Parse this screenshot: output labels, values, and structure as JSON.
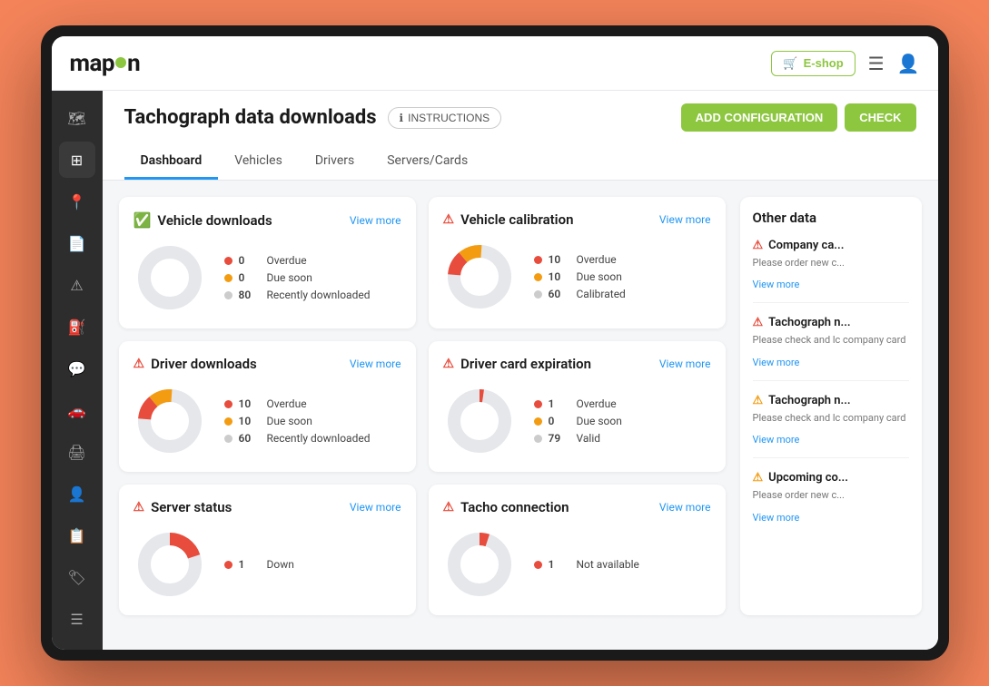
{
  "app": {
    "logo": "map",
    "logo_highlight": "on",
    "eshop_label": "E-shop",
    "page_title": "Tachograph data downloads",
    "instructions_label": "INSTRUCTIONS",
    "add_config_label": "ADD CONFIGURATION",
    "check_label": "CHECK"
  },
  "tabs": [
    {
      "label": "Dashboard",
      "active": true
    },
    {
      "label": "Vehicles",
      "active": false
    },
    {
      "label": "Drivers",
      "active": false
    },
    {
      "label": "Servers/Cards",
      "active": false
    }
  ],
  "cards": [
    {
      "id": "vehicle-downloads",
      "title": "Vehicle downloads",
      "status": "ok",
      "view_more": "View more",
      "legend": [
        {
          "color": "#e74c3c",
          "count": "0",
          "label": "Overdue"
        },
        {
          "color": "#f39c12",
          "count": "0",
          "label": "Due soon"
        },
        {
          "color": "#cccccc",
          "count": "80",
          "label": "Recently downloaded"
        }
      ],
      "donut": {
        "segments": [
          {
            "color": "#e5e7eb",
            "value": 100
          }
        ]
      }
    },
    {
      "id": "vehicle-calibration",
      "title": "Vehicle calibration",
      "status": "warn",
      "view_more": "View more",
      "legend": [
        {
          "color": "#e74c3c",
          "count": "10",
          "label": "Overdue"
        },
        {
          "color": "#f39c12",
          "count": "10",
          "label": "Due soon"
        },
        {
          "color": "#cccccc",
          "count": "60",
          "label": "Calibrated"
        }
      ],
      "donut": {
        "segments": [
          {
            "color": "#e74c3c",
            "value": 12.5
          },
          {
            "color": "#f39c12",
            "value": 12.5
          },
          {
            "color": "#e5e7eb",
            "value": 75
          }
        ]
      }
    },
    {
      "id": "driver-downloads",
      "title": "Driver downloads",
      "status": "warn",
      "view_more": "View more",
      "legend": [
        {
          "color": "#e74c3c",
          "count": "10",
          "label": "Overdue"
        },
        {
          "color": "#f39c12",
          "count": "10",
          "label": "Due soon"
        },
        {
          "color": "#cccccc",
          "count": "60",
          "label": "Recently downloaded"
        }
      ],
      "donut": {
        "segments": [
          {
            "color": "#e74c3c",
            "value": 12.5
          },
          {
            "color": "#f39c12",
            "value": 12.5
          },
          {
            "color": "#e5e7eb",
            "value": 75
          }
        ]
      }
    },
    {
      "id": "driver-card-expiration",
      "title": "Driver card expiration",
      "status": "warn",
      "view_more": "View more",
      "legend": [
        {
          "color": "#e74c3c",
          "count": "1",
          "label": "Overdue"
        },
        {
          "color": "#f39c12",
          "count": "0",
          "label": "Due soon"
        },
        {
          "color": "#cccccc",
          "count": "79",
          "label": "Valid"
        }
      ],
      "donut": {
        "segments": [
          {
            "color": "#e74c3c",
            "value": 1.25
          },
          {
            "color": "#e5e7eb",
            "value": 98.75
          }
        ]
      }
    },
    {
      "id": "server-status",
      "title": "Server status",
      "status": "warn",
      "view_more": "View more",
      "legend": [
        {
          "color": "#e74c3c",
          "count": "1",
          "label": "Down"
        }
      ],
      "donut": {
        "segments": [
          {
            "color": "#e74c3c",
            "value": 20
          },
          {
            "color": "#e5e7eb",
            "value": 80
          }
        ]
      }
    },
    {
      "id": "tacho-connection",
      "title": "Tacho connection",
      "status": "warn",
      "view_more": "View more",
      "legend": [
        {
          "color": "#e74c3c",
          "count": "1",
          "label": "Not available"
        }
      ],
      "donut": {
        "segments": [
          {
            "color": "#e74c3c",
            "value": 5
          },
          {
            "color": "#e5e7eb",
            "value": 95
          }
        ]
      }
    }
  ],
  "right_panel": {
    "title": "Other data",
    "notifications": [
      {
        "icon": "warn-red",
        "title": "Company ca...",
        "desc": "Please order new c...",
        "link": "View more"
      },
      {
        "icon": "warn-red",
        "title": "Tachograph n...",
        "desc": "Please check and lc company card",
        "link": "View more"
      },
      {
        "icon": "warn-yellow",
        "title": "Tachograph n...",
        "desc": "Please check and lc company card",
        "link": "View more"
      },
      {
        "icon": "warn-yellow",
        "title": "Upcoming co...",
        "desc": "Please order new c...",
        "link": "View more"
      }
    ]
  },
  "sidebar": {
    "items": [
      {
        "icon": "🗺",
        "name": "map"
      },
      {
        "icon": "⊞",
        "name": "dashboard"
      },
      {
        "icon": "📍",
        "name": "location"
      },
      {
        "icon": "📄",
        "name": "reports"
      },
      {
        "icon": "⚠",
        "name": "alerts"
      },
      {
        "icon": "⛽",
        "name": "fuel"
      },
      {
        "icon": "💬",
        "name": "messages"
      },
      {
        "icon": "🚗",
        "name": "vehicles"
      },
      {
        "icon": "🖨",
        "name": "tachograph"
      },
      {
        "icon": "👤",
        "name": "profile"
      },
      {
        "icon": "📋",
        "name": "documents"
      },
      {
        "icon": "🏷",
        "name": "tags"
      },
      {
        "icon": "☰",
        "name": "menu"
      }
    ]
  }
}
